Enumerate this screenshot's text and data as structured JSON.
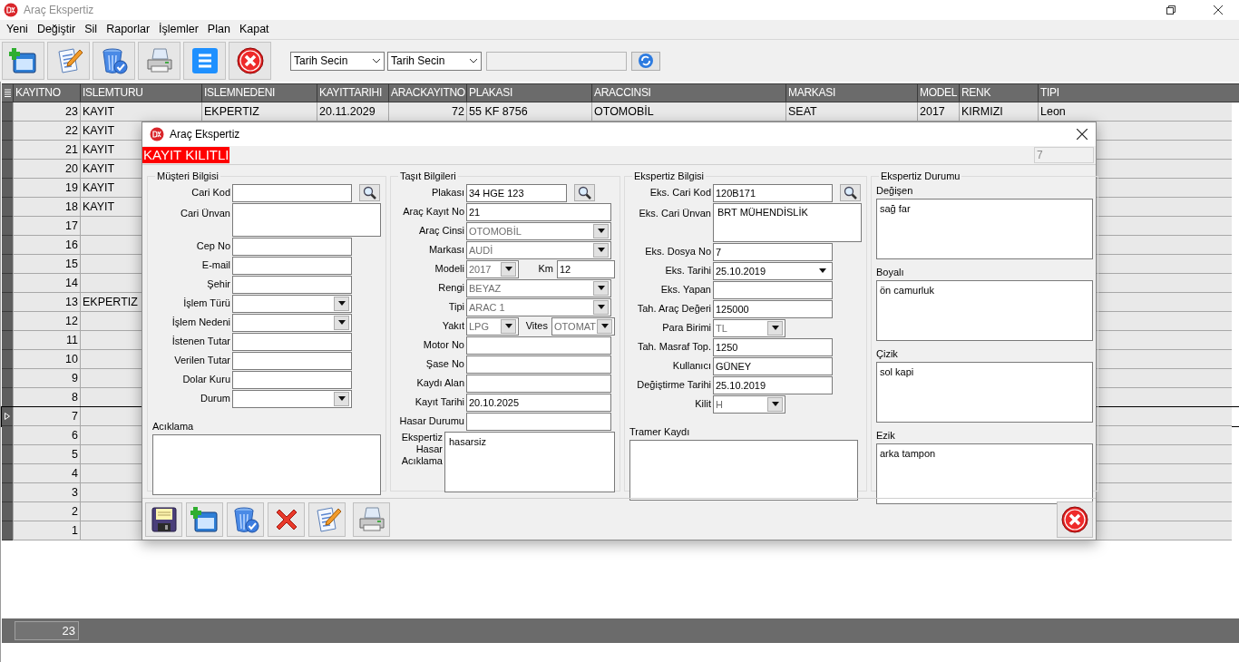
{
  "window": {
    "title": "Araç Ekspertiz"
  },
  "menu": [
    "Yeni",
    "Değiştir",
    "Sil",
    "Raporlar",
    "İşlemler",
    "Plan",
    "Kapat"
  ],
  "toolbar": {
    "date_filters": [
      {
        "value": "Tarih Secin"
      },
      {
        "value": "Tarih Secin"
      }
    ]
  },
  "grid": {
    "columns": [
      "KAYITNO",
      "ISLEMTURU",
      "ISLEMNEDENI",
      "KAYITTARIHI",
      "ARACKAYITNO",
      "PLAKASI",
      "ARACCINSI",
      "MARKASI",
      "MODEL",
      "RENK",
      "TIPI"
    ],
    "rows": [
      {
        "cells": [
          "23",
          "KAYIT",
          "EKPERTIZ",
          "20.11.2029",
          "72",
          "55 KF 8756",
          "OTOMOBİL",
          "SEAT",
          "2017",
          "KIRMIZI",
          "Leon"
        ],
        "selected": false
      },
      {
        "cells": [
          "22",
          "KAYIT"
        ],
        "selected": false
      },
      {
        "cells": [
          "21",
          "KAYIT"
        ],
        "selected": false
      },
      {
        "cells": [
          "20",
          "KAYIT"
        ],
        "selected": false
      },
      {
        "cells": [
          "19",
          "KAYIT"
        ],
        "selected": false
      },
      {
        "cells": [
          "18",
          "KAYIT"
        ],
        "selected": false
      },
      {
        "cells": [
          "17"
        ],
        "selected": false
      },
      {
        "cells": [
          "16"
        ],
        "selected": false
      },
      {
        "cells": [
          "15"
        ],
        "selected": false
      },
      {
        "cells": [
          "14"
        ],
        "selected": false
      },
      {
        "cells": [
          "13",
          "EKPERTIZ"
        ],
        "selected": false
      },
      {
        "cells": [
          "12"
        ],
        "selected": false
      },
      {
        "cells": [
          "11"
        ],
        "selected": false
      },
      {
        "cells": [
          "10"
        ],
        "selected": false
      },
      {
        "cells": [
          "9"
        ],
        "selected": false
      },
      {
        "cells": [
          "8"
        ],
        "selected": false
      },
      {
        "cells": [
          "7"
        ],
        "selected": true
      },
      {
        "cells": [
          "6"
        ],
        "selected": false
      },
      {
        "cells": [
          "5"
        ],
        "selected": false
      },
      {
        "cells": [
          "4"
        ],
        "selected": false
      },
      {
        "cells": [
          "3"
        ],
        "selected": false
      },
      {
        "cells": [
          "2"
        ],
        "selected": false
      },
      {
        "cells": [
          "1"
        ],
        "selected": false
      }
    ]
  },
  "status_bar": {
    "count": "23"
  },
  "dialog": {
    "title": "Araç Ekspertiz",
    "lock_label": "KAYIT KILITLI",
    "record_no": "7",
    "groups": [
      {
        "title": "Müşteri Bilgisi",
        "fields": [
          {
            "label": "Cari Kod",
            "kind": "search"
          },
          {
            "label": "Cari Ünvan",
            "kind": "memo"
          },
          {
            "label": "Cep No",
            "kind": "input"
          },
          {
            "label": "E-mail",
            "kind": "input"
          },
          {
            "label": "Şehir",
            "kind": "input"
          },
          {
            "label": "İşlem Türü",
            "kind": "combo"
          },
          {
            "label": "İşlem Nedeni",
            "kind": "combo"
          },
          {
            "label": "İstenen Tutar",
            "kind": "input"
          },
          {
            "label": "Verilen Tutar",
            "kind": "input"
          },
          {
            "label": "Dolar Kuru",
            "kind": "input"
          },
          {
            "label": "Durum",
            "kind": "combo"
          },
          {
            "label": "Acıklama",
            "kind": "memo_below"
          }
        ]
      },
      {
        "title": "Taşıt Bilgileri",
        "fields": [
          {
            "label": "Plakası",
            "kind": "search",
            "value": "34 HGE 123"
          },
          {
            "label": "Araç Kayıt No",
            "kind": "input",
            "value": "21"
          },
          {
            "label": "Araç Cinsi",
            "kind": "combo",
            "value": "OTOMOBİL",
            "disabled": true
          },
          {
            "label": "Markası",
            "kind": "combo",
            "value": "AUDİ",
            "disabled": true
          },
          {
            "kind": "pair",
            "left": {
              "label": "Modeli",
              "kind": "small_combo",
              "value": "2017",
              "disabled": true
            },
            "right": {
              "label": "Km",
              "kind": "input",
              "value": "12"
            }
          },
          {
            "label": "Rengi",
            "kind": "combo",
            "value": "BEYAZ",
            "disabled": true
          },
          {
            "label": "Tipi",
            "kind": "combo",
            "value": "ARAC 1",
            "disabled": true
          },
          {
            "kind": "pair",
            "left": {
              "label": "Yakıt",
              "kind": "small_combo",
              "value": "LPG",
              "disabled": true
            },
            "right": {
              "label": "Vites",
              "kind": "small_combo",
              "value": "OTOMAT",
              "disabled": true
            }
          },
          {
            "label": "Motor No",
            "kind": "input"
          },
          {
            "label": "Şase No",
            "kind": "input"
          },
          {
            "label": "Kaydı Alan",
            "kind": "input"
          },
          {
            "label": "Kayıt Tarihi",
            "kind": "input",
            "value": "20.10.2025"
          },
          {
            "label": "Hasar Durumu",
            "kind": "input"
          },
          {
            "label": "Ekspertiz Hasar Acıklama",
            "kind": "memo_tall",
            "value": "hasarsiz"
          }
        ]
      },
      {
        "title": "Ekspertiz Bilgisi",
        "fields": [
          {
            "label": "Eks. Cari Kod",
            "kind": "search",
            "value": "120B171"
          },
          {
            "label": "Eks. Cari Ünvan",
            "kind": "memo",
            "value": "BRT MÜHENDİSLİK"
          },
          {
            "label": "Eks. Dosya No",
            "kind": "input",
            "value": "7"
          },
          {
            "label": "Eks. Tarihi",
            "kind": "date",
            "value": "25.10.2019"
          },
          {
            "label": "Eks. Yapan",
            "kind": "input"
          },
          {
            "label": "Tah. Araç Değeri",
            "kind": "input",
            "value": "125000"
          },
          {
            "label": "Para Birimi",
            "kind": "small_combo",
            "value": "TL",
            "disabled": true
          },
          {
            "label": "Tah. Masraf Top.",
            "kind": "input",
            "value": "1250"
          },
          {
            "label": "Kullanıcı",
            "kind": "input",
            "value": "GÜNEY"
          },
          {
            "label": "Değiştirme Tarihi",
            "kind": "input",
            "value": "25.10.2019"
          },
          {
            "label": "Kilit",
            "kind": "small_combo",
            "value": "H",
            "disabled": true
          },
          {
            "label": "Tramer Kaydı",
            "kind": "memo_below"
          }
        ]
      },
      {
        "title": "Ekspertiz Durumu",
        "fields": [
          {
            "label": "Değişen",
            "kind": "memo_below",
            "value": "sağ far"
          },
          {
            "label": "Boyalı",
            "kind": "memo_below",
            "value": "ön camurluk"
          },
          {
            "label": "Çizik",
            "kind": "memo_below",
            "value": "sol kapi"
          },
          {
            "label": "Ezik",
            "kind": "memo_below",
            "value": "arka tampon"
          }
        ]
      }
    ]
  }
}
